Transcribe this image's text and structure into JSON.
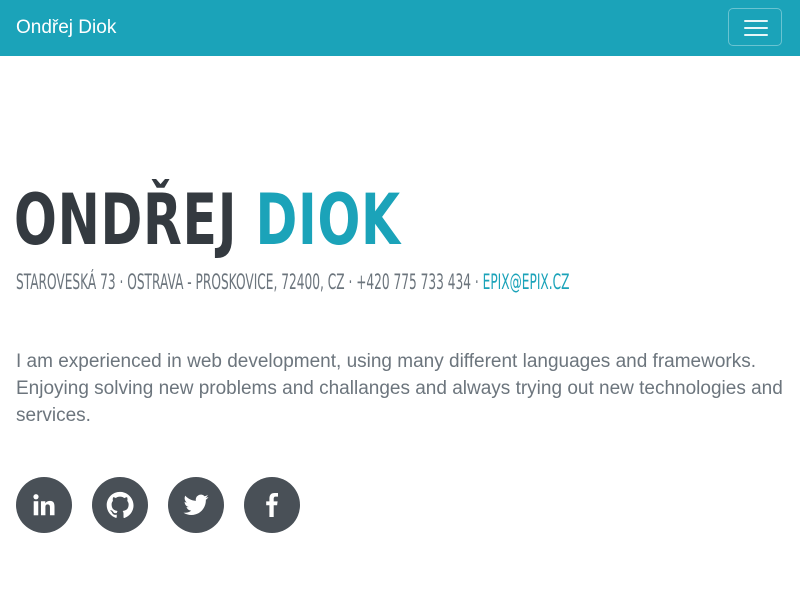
{
  "navbar": {
    "brand": "Ondřej Diok",
    "toggler_icon": "hamburger-icon",
    "background_color": "#1ba3b9"
  },
  "hero": {
    "first_name": "Ondřej",
    "last_name": "Diok",
    "address": "Staroveská 73 · Ostrava - Proskovice, 72400, CZ · +420 775 733 434 ·",
    "email": "epix@epix.cz",
    "intro": "I am experienced in web development, using many different languages and frameworks. Enjoying solving new problems and challanges and always trying out new technologies and services."
  },
  "social": [
    {
      "name": "linkedin",
      "icon": "linkedin-icon"
    },
    {
      "name": "github",
      "icon": "github-icon"
    },
    {
      "name": "twitter",
      "icon": "twitter-icon"
    },
    {
      "name": "facebook",
      "icon": "facebook-icon"
    }
  ],
  "colors": {
    "accent": "#1ba3b9",
    "heading_dark": "#343a40",
    "muted_text": "#6c757d",
    "social_button": "#495057"
  }
}
